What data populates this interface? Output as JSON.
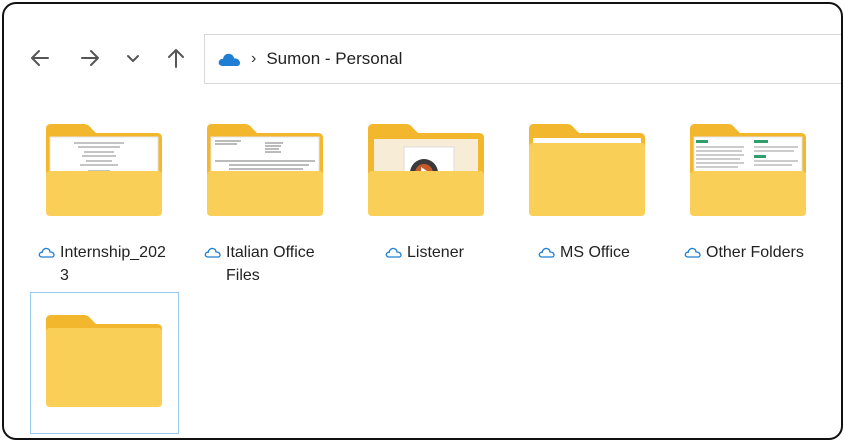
{
  "nav": {
    "back_icon": "arrow-left-icon",
    "forward_icon": "arrow-right-icon",
    "recent_icon": "chevron-down-icon",
    "up_icon": "arrow-up-icon"
  },
  "address": {
    "icon": "onedrive-cloud-icon",
    "crumb": "Sumon - Personal"
  },
  "folders": [
    {
      "name": "Internship_202\n3",
      "preview": "document"
    },
    {
      "name": "Italian Office Files",
      "preview": "document"
    },
    {
      "name": "Listener",
      "preview": "media"
    },
    {
      "name": "MS Office",
      "preview": "blank-sheet"
    },
    {
      "name": "Other Folders",
      "preview": "document-green"
    },
    {
      "name": "",
      "preview": "none",
      "selected": true
    }
  ],
  "colors": {
    "folder_front": "#f9cf58",
    "folder_back": "#f3b72d",
    "onedrive_blue": "#1f7fd4"
  }
}
